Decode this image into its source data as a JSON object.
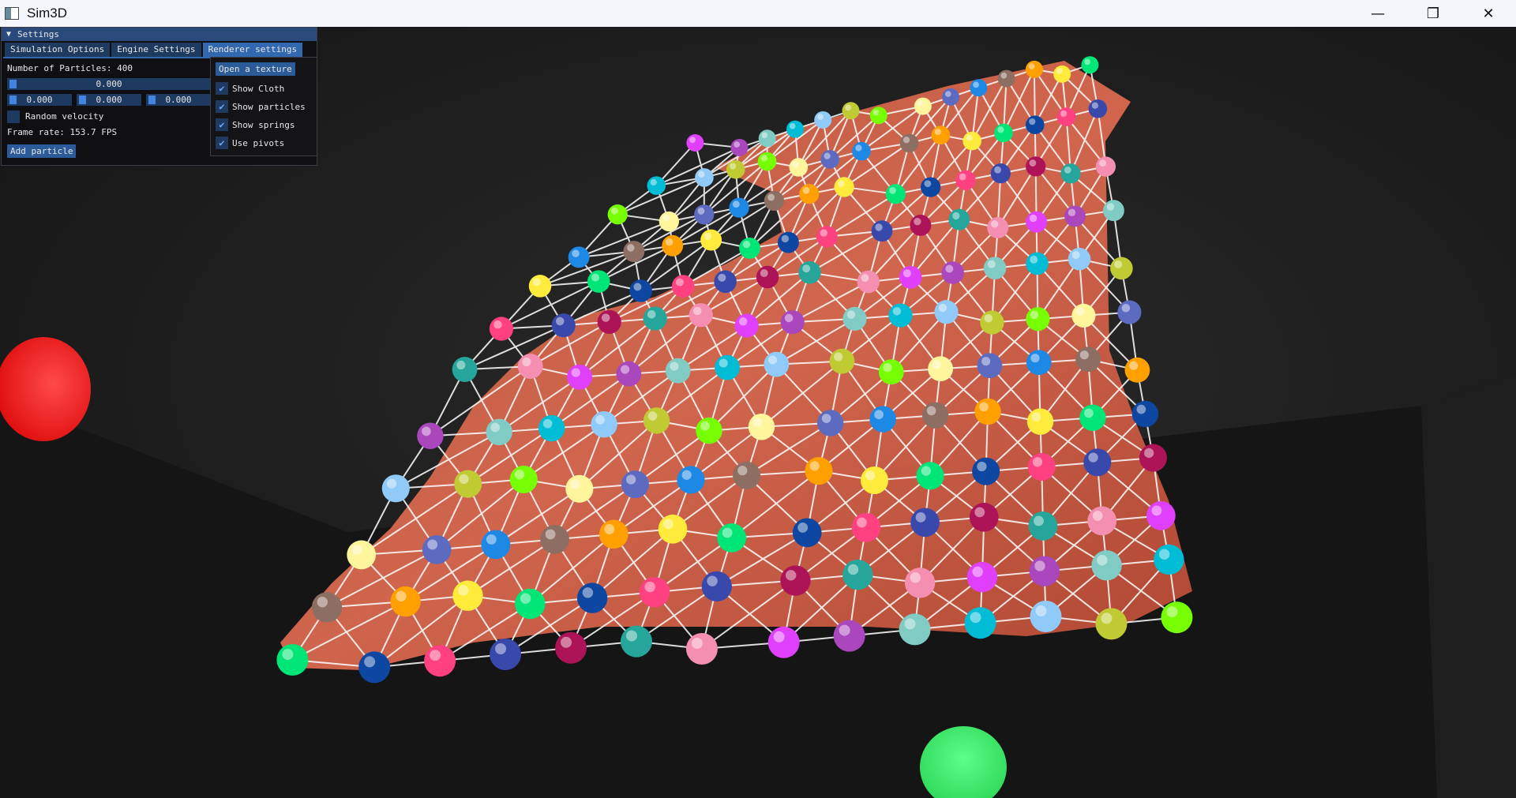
{
  "window": {
    "title": "Sim3D",
    "controls": [
      "minimize",
      "restore",
      "close"
    ]
  },
  "settings_panel": {
    "title": "Settings",
    "tabs": [
      {
        "label": "Simulation Options"
      },
      {
        "label": "Engine Settings"
      },
      {
        "label": "Renderer settings"
      }
    ],
    "num_particles_label": "Number of Particles: 400",
    "slider_main": "0.000",
    "slider_x": "0.000",
    "slider_y": "0.000",
    "slider_z": "0.000",
    "random_velocity_label": "Random velocity",
    "frame_rate_label": "Frame rate: 153.7 FPS",
    "add_particle_label": "Add particle"
  },
  "renderer_popup": {
    "open_texture_label": "Open a texture",
    "options": [
      {
        "label": "Show Cloth",
        "checked": true
      },
      {
        "label": "Show particles",
        "checked": true
      },
      {
        "label": "Show springs",
        "checked": true
      },
      {
        "label": "Use pivots",
        "checked": true
      }
    ]
  },
  "scene": {
    "background": "#1b1b1b",
    "cloth_color": "#c9553d",
    "red_sphere_color": "#ff2020",
    "green_sphere_color": "#3ef36a",
    "particle_colors": [
      "#e040fb",
      "#00bcd4",
      "#76ff03",
      "#1e88e5",
      "#ffeb3b",
      "#ff4081",
      "#26a69a",
      "#ab47bc",
      "#90caf9",
      "#fff59d",
      "#8d6e63",
      "#00e676",
      "#3949ab",
      "#f48fb1",
      "#80cbc4",
      "#c0ca33",
      "#5c6bc0",
      "#ffa000",
      "#0d47a1",
      "#ad1457"
    ]
  }
}
